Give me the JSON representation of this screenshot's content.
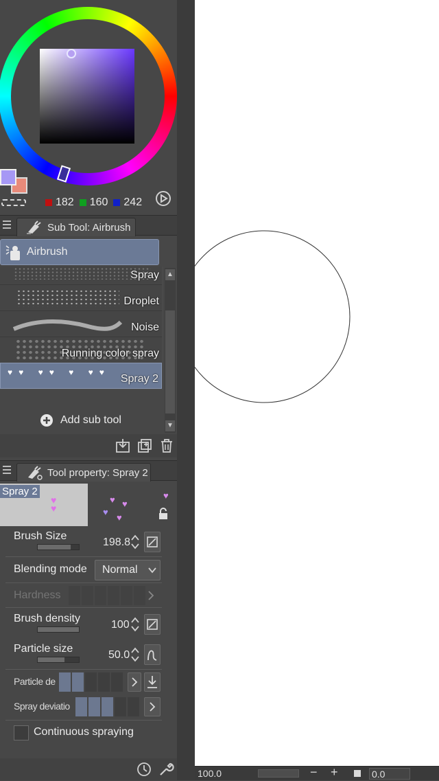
{
  "color_panel": {
    "rgb": {
      "r": "182",
      "g": "160",
      "b": "242"
    },
    "main_color": "#a090f2",
    "sub_color": "#e08070"
  },
  "sub_tool_panel": {
    "title": "Sub Tool: Airbrush",
    "group": "Airbrush",
    "items": [
      {
        "label": "Spray"
      },
      {
        "label": "Droplet"
      },
      {
        "label": "Noise"
      },
      {
        "label": "Running color spray"
      },
      {
        "label": "Spray 2"
      }
    ],
    "selected": "Spray 2",
    "add_label": "Add sub tool"
  },
  "tool_property_panel": {
    "title": "Tool property: Spray 2",
    "preview_label": "Spray 2",
    "brush_size": {
      "label": "Brush Size",
      "value": "198.8"
    },
    "blending_mode": {
      "label": "Blending mode",
      "value": "Normal"
    },
    "hardness": {
      "label": "Hardness"
    },
    "brush_density": {
      "label": "Brush density",
      "value": "100"
    },
    "particle_size": {
      "label": "Particle size",
      "value": "50.0"
    },
    "particle_density": {
      "label": "Particle de"
    },
    "spray_deviation": {
      "label": "Spray deviatio"
    },
    "continuous_spraying": {
      "label": "Continuous spraying",
      "checked": false
    }
  },
  "status_bar": {
    "zoom": "100.0",
    "angle": "0.0"
  },
  "colors": {
    "panel_bg": "#474747",
    "selection": "#6b7a96",
    "canvas": "#ffffff"
  }
}
